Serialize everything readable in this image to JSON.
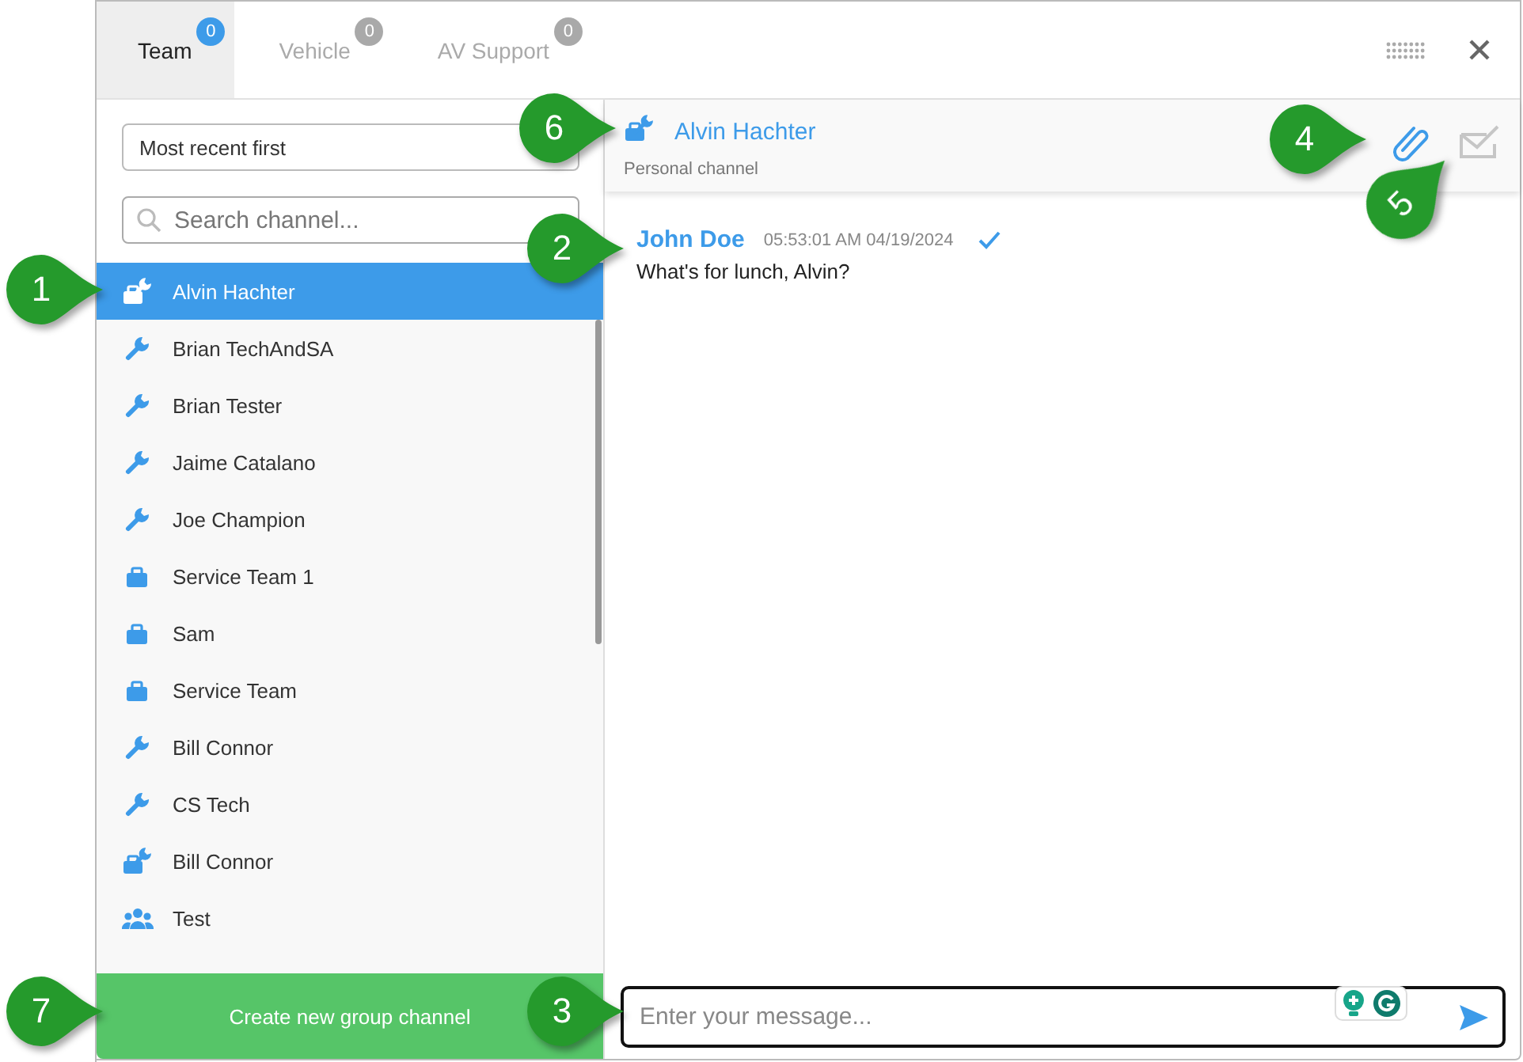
{
  "tabs": [
    {
      "label": "Team",
      "count": "0",
      "selected": true
    },
    {
      "label": "Vehicle",
      "count": "0",
      "selected": false
    },
    {
      "label": "AV Support",
      "count": "0",
      "selected": false
    }
  ],
  "sidebar": {
    "sort": "Most recent first",
    "search": {
      "placeholder": "Search channel..."
    },
    "channels": [
      {
        "name": "Alvin Hachter",
        "kind": "personal",
        "selected": true
      },
      {
        "name": "Brian TechAndSA",
        "kind": "tech",
        "selected": false
      },
      {
        "name": "Brian Tester",
        "kind": "tech",
        "selected": false
      },
      {
        "name": "Jaime Catalano",
        "kind": "tech",
        "selected": false
      },
      {
        "name": "Joe Champion",
        "kind": "tech",
        "selected": false
      },
      {
        "name": "Service Team 1",
        "kind": "team",
        "selected": false
      },
      {
        "name": "Sam",
        "kind": "team",
        "selected": false
      },
      {
        "name": "Service Team",
        "kind": "team",
        "selected": false
      },
      {
        "name": "Bill Connor",
        "kind": "tech",
        "selected": false
      },
      {
        "name": "CS Tech",
        "kind": "tech",
        "selected": false
      },
      {
        "name": "Bill Connor",
        "kind": "personal",
        "selected": false
      },
      {
        "name": "Test",
        "kind": "group",
        "selected": false
      }
    ],
    "create_button": "Create new group channel"
  },
  "channel_header": {
    "name": "Alvin Hachter",
    "kind": "personal",
    "subtitle": "Personal channel"
  },
  "messages": [
    {
      "author": "John Doe",
      "time": "05:53:01 AM 04/19/2024",
      "text": "What's for lunch, Alvin?",
      "delivered": true
    }
  ],
  "composer": {
    "placeholder": "Enter your message..."
  },
  "callouts": [
    {
      "number": "1"
    },
    {
      "number": "2"
    },
    {
      "number": "3"
    },
    {
      "number": "4"
    },
    {
      "number": "5"
    },
    {
      "number": "6"
    },
    {
      "number": "7"
    }
  ]
}
